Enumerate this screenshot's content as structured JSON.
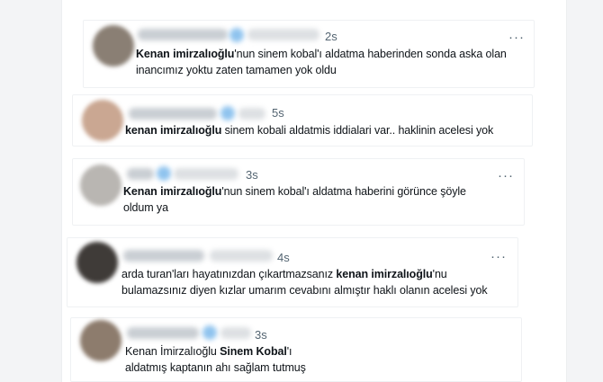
{
  "tweets": [
    {
      "time": "2s",
      "avatar_color": "#8a7f74",
      "bold": "Kenan imirzalıoğlu",
      "rest": "'nun sinem kobal'ı aldatma haberinden sonda aska olan inancımız yoktu zaten tamamen yok oldu"
    },
    {
      "time": "5s",
      "avatar_color": "#caa792",
      "bold": "kenan imirzalıoğlu",
      "rest": " sinem kobali aldatmis iddialari var.. haklinin acelesi yok"
    },
    {
      "time": "3s",
      "avatar_color": "#b9b6b2",
      "bold": "Kenan imirzalıoğlu",
      "rest": "'nun sinem kobal'ı aldatma haberini görünce şöyle oldum ya"
    },
    {
      "time": "4s",
      "avatar_color": "#3f3b38",
      "pre": "arda turan'ları hayatınızdan çıkartmazsanız ",
      "bold": "kenan imirzalıoğlu",
      "rest": "'nu bulamazsınız diyen kızlar umarım cevabını almıştır haklı olanın acelesi yok"
    },
    {
      "time": "3s",
      "avatar_color": "#8d7c6d",
      "pre": "Kenan İmirzalıoğlu ",
      "bold": "Sinem Kobal",
      "rest": "'ı aldatmış kaptanın ahı sağlam tutmuş"
    }
  ],
  "more_label": "···"
}
